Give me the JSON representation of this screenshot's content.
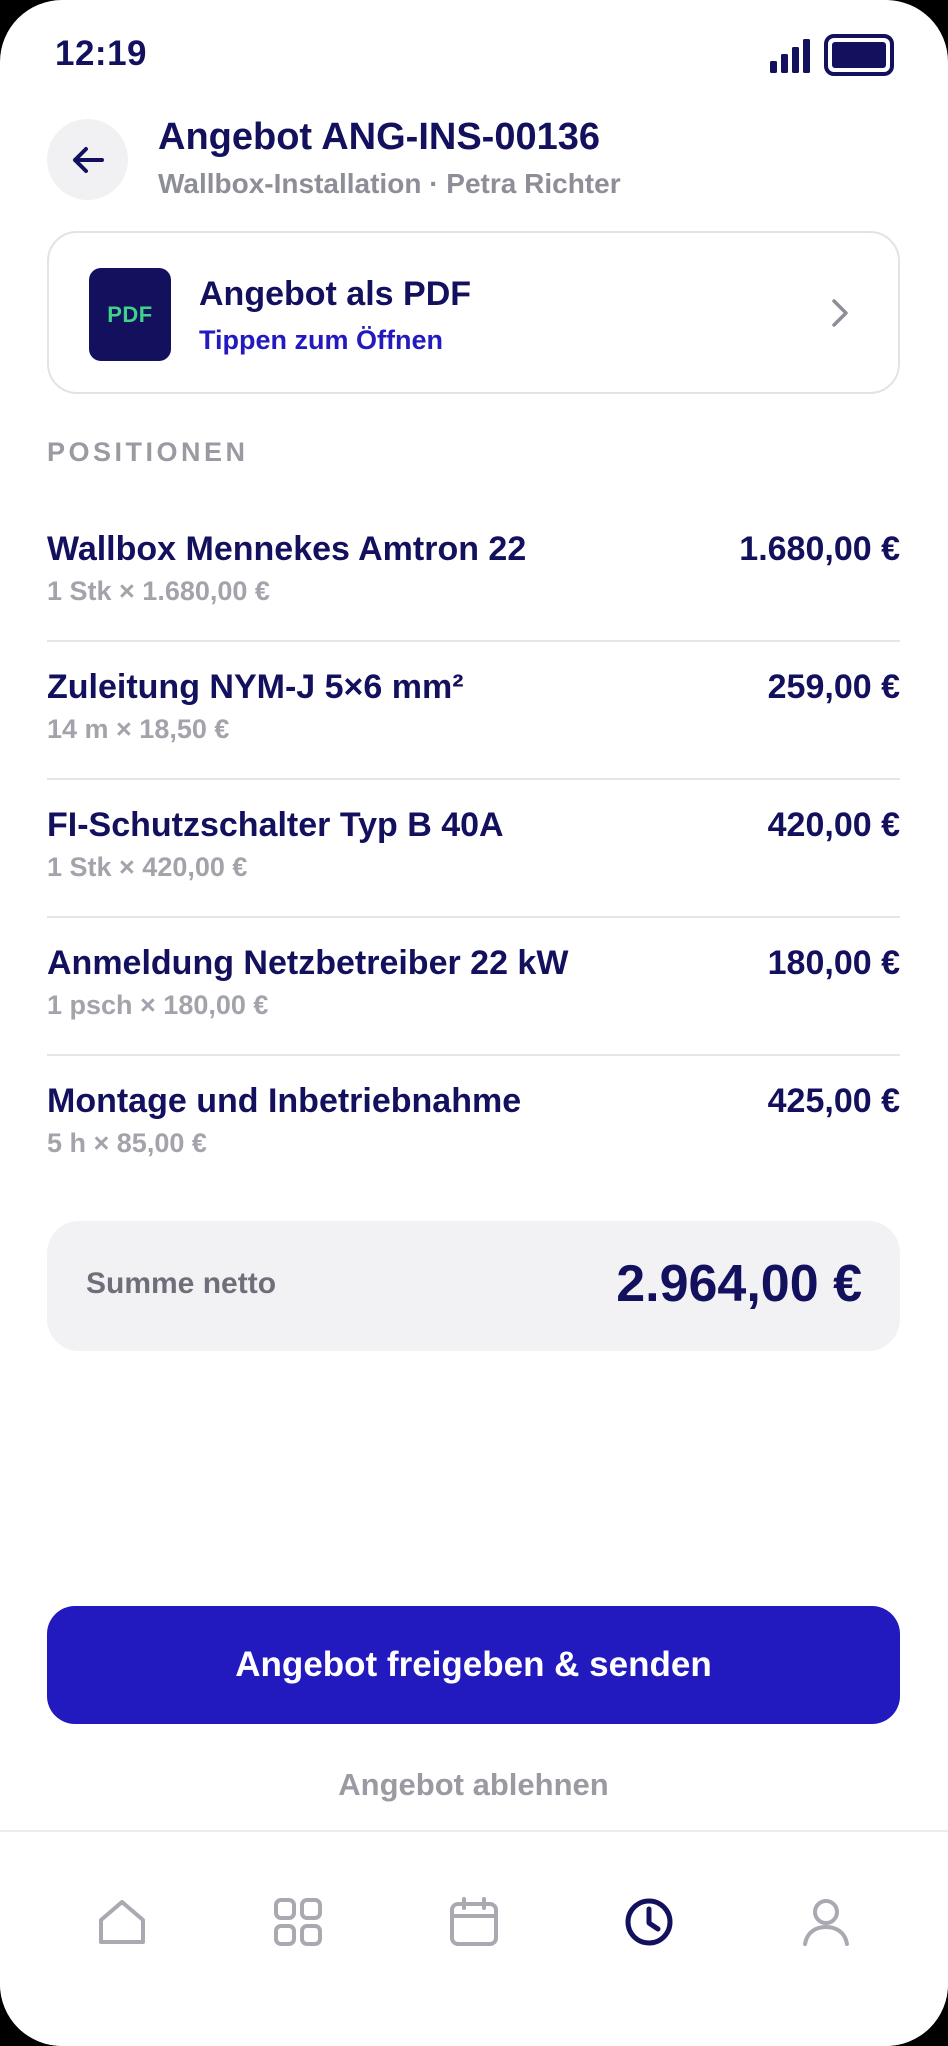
{
  "status_bar": {
    "time": "12:19"
  },
  "header": {
    "title": "Angebot ANG-INS-00136",
    "subtitle": "Wallbox-Installation · Petra Richter"
  },
  "pdf_card": {
    "badge": "PDF",
    "title": "Angebot als PDF",
    "subtitle": "Tippen zum Öffnen"
  },
  "section_label": "POSITIONEN",
  "positions": [
    {
      "name": "Wallbox Mennekes Amtron 22",
      "detail": "1 Stk × 1.680,00 €",
      "amount": "1.680,00 €"
    },
    {
      "name": "Zuleitung NYM-J 5×6 mm²",
      "detail": "14 m × 18,50 €",
      "amount": "259,00 €"
    },
    {
      "name": "FI-Schutzschalter Typ B 40A",
      "detail": "1 Stk × 420,00 €",
      "amount": "420,00 €"
    },
    {
      "name": "Anmeldung Netzbetreiber 22 kW",
      "detail": "1 psch × 180,00 €",
      "amount": "180,00 €"
    },
    {
      "name": "Montage und Inbetriebnahme",
      "detail": "5 h × 85,00 €",
      "amount": "425,00 €"
    }
  ],
  "total": {
    "label": "Summe netto",
    "value": "2.964,00 €"
  },
  "actions": {
    "primary_label": "Angebot freigeben & senden",
    "secondary_label": "Angebot ablehnen"
  },
  "bottom_nav": {
    "items": [
      "home-icon",
      "grid-icon",
      "calendar-icon",
      "clock-icon",
      "user-icon"
    ],
    "active": "clock-icon"
  },
  "colors": {
    "primary": "#2219bf",
    "navy": "#13105e",
    "muted": "#9a9aa3",
    "pdf_accent": "#3fd38a"
  }
}
